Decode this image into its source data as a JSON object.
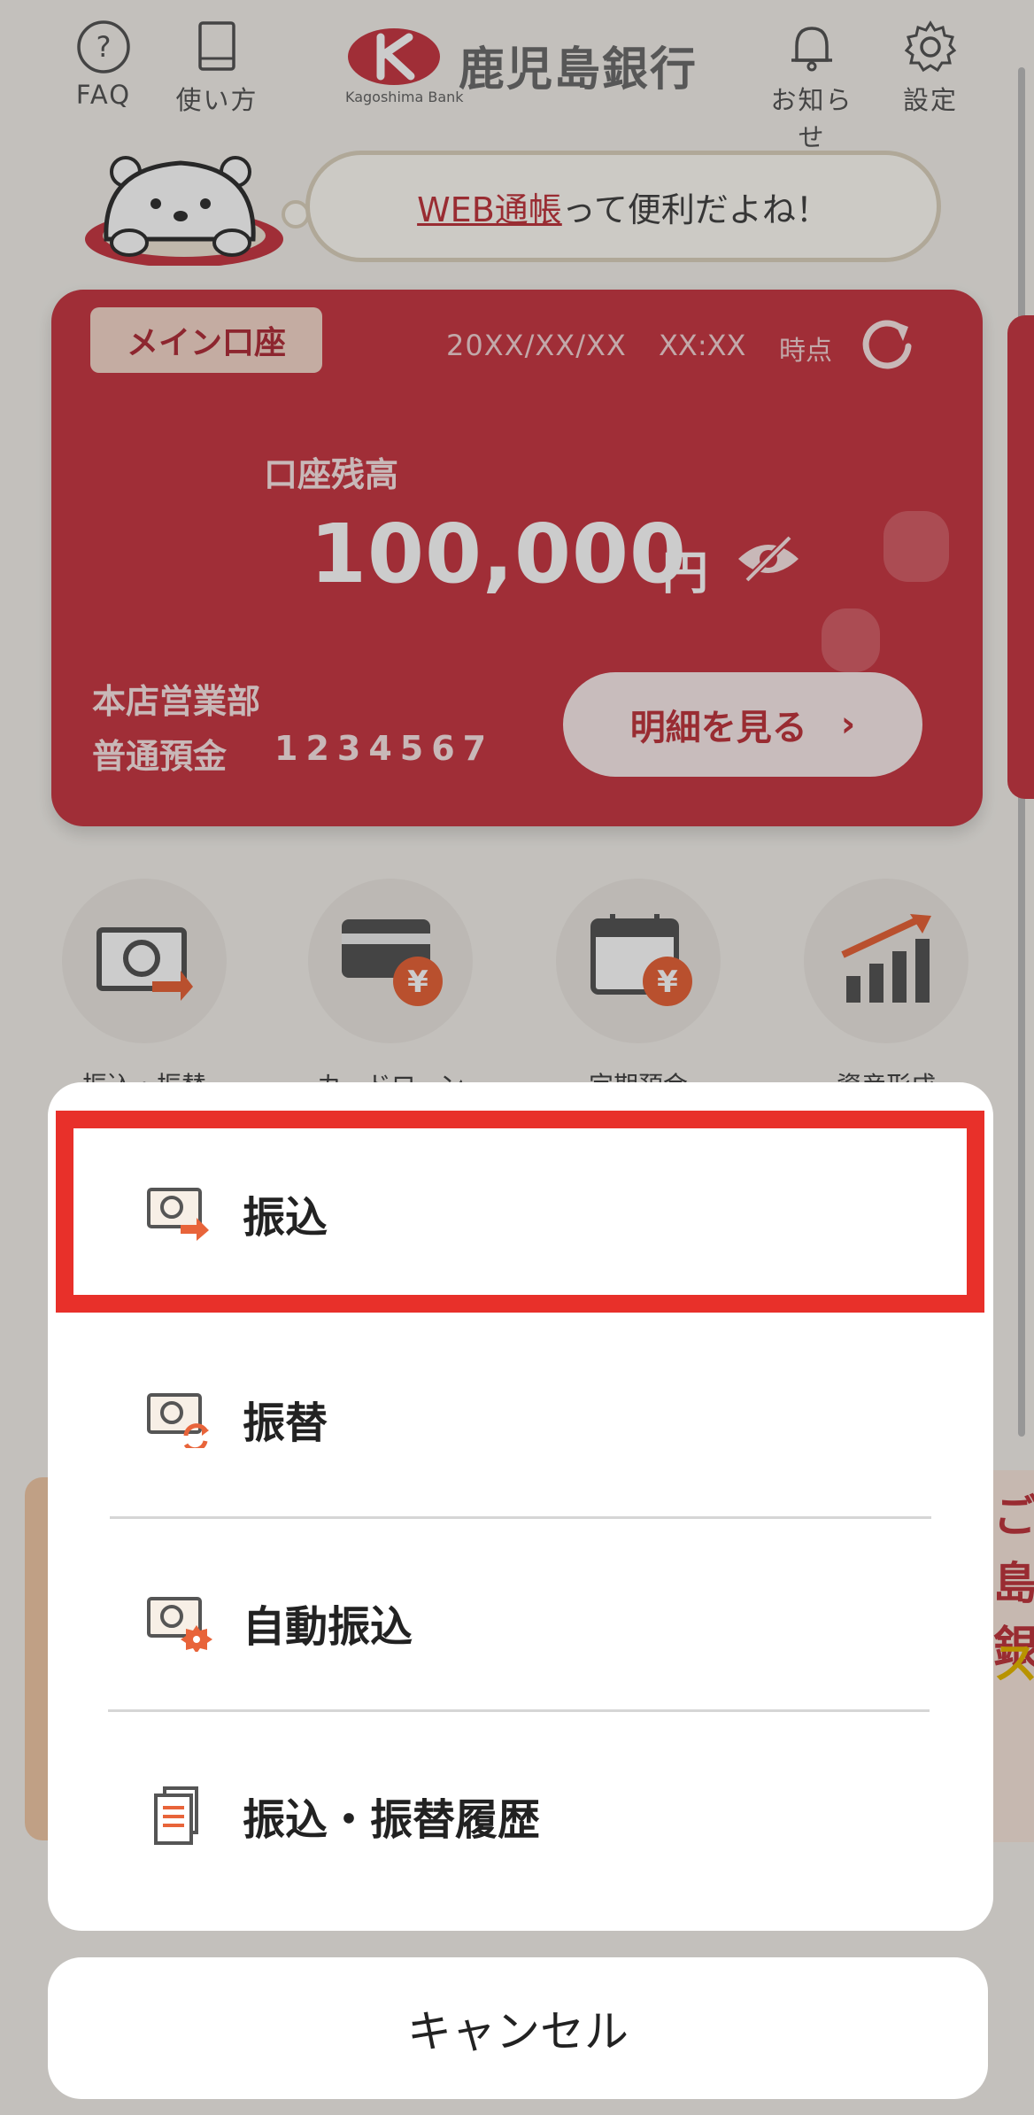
{
  "header": {
    "faq_label": "FAQ",
    "howto_label": "使い方",
    "bank_name": "鹿児島銀行",
    "bank_name_en": "Kagoshima Bank",
    "notice_label": "お知らせ",
    "settings_label": "設定"
  },
  "banner": {
    "link_text": "WEB通帳",
    "rest_text": "って便利だよね！"
  },
  "account": {
    "tag": "メイン口座",
    "date": "20XX/XX/XX",
    "time": "XX:XX",
    "as_of": "時点",
    "balance_label": "口座残高",
    "balance": "100,000",
    "unit": "円",
    "branch": "本店営業部",
    "account_type": "普通預金",
    "account_number": "1234567",
    "detail_button": "明細を見る"
  },
  "quick_menu": [
    {
      "label": "振込・振替",
      "icon": "transfer-icon"
    },
    {
      "label": "カードローン",
      "icon": "card-loan-icon"
    },
    {
      "label": "定期預金",
      "icon": "time-deposit-icon"
    },
    {
      "label": "資産形成",
      "icon": "asset-growth-icon"
    }
  ],
  "background_banner": {
    "line1": "ご",
    "line2": "島銀",
    "line3": "ス"
  },
  "action_sheet": {
    "items": [
      {
        "label": "振込",
        "icon": "transfer-arrow-icon"
      },
      {
        "label": "振替",
        "icon": "transfer-refresh-icon"
      },
      {
        "label": "自動振込",
        "icon": "auto-transfer-gear-icon"
      },
      {
        "label": "振込・振替履歴",
        "icon": "history-document-icon"
      }
    ],
    "cancel_label": "キャンセル"
  },
  "colors": {
    "brand_red": "#c83a45",
    "highlight_red": "#e8302a",
    "accent_orange": "#e8643a"
  }
}
